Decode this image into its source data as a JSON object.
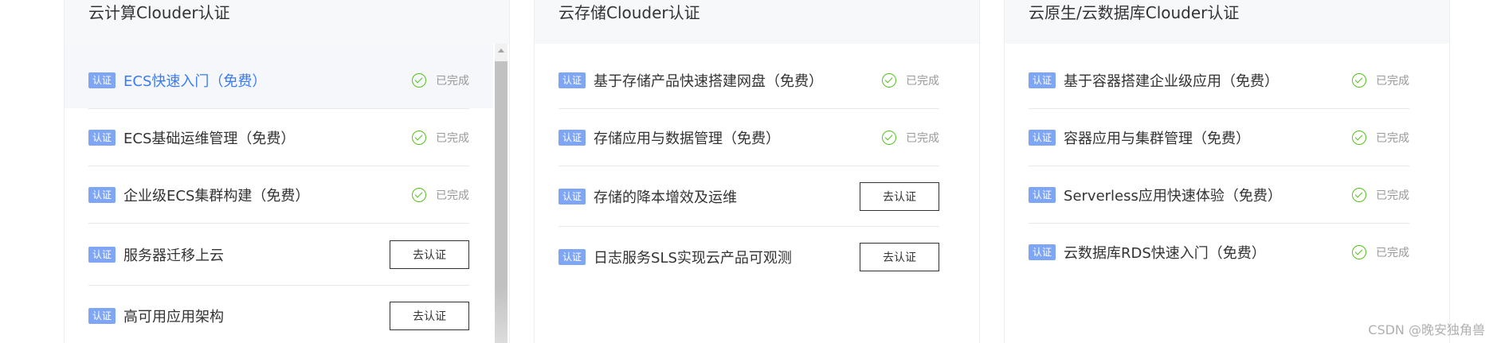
{
  "columns": [
    {
      "title": "云计算Clouder认证",
      "items": [
        {
          "tag": "认证",
          "title": "ECS快速入门（免费）",
          "status": "已完成"
        },
        {
          "tag": "认证",
          "title": "ECS基础运维管理（免费）",
          "status": "已完成"
        },
        {
          "tag": "认证",
          "title": "企业级ECS集群构建（免费）",
          "status": "已完成"
        },
        {
          "tag": "认证",
          "title": "服务器迁移上云",
          "action": "去认证"
        },
        {
          "tag": "认证",
          "title": "高可用应用架构",
          "action": "去认证"
        }
      ]
    },
    {
      "title": "云存储Clouder认证",
      "items": [
        {
          "tag": "认证",
          "title": "基于存储产品快速搭建网盘（免费）",
          "status": "已完成"
        },
        {
          "tag": "认证",
          "title": "存储应用与数据管理（免费）",
          "status": "已完成"
        },
        {
          "tag": "认证",
          "title": "存储的降本增效及运维",
          "action": "去认证"
        },
        {
          "tag": "认证",
          "title": "日志服务SLS实现云产品可观测",
          "action": "去认证"
        }
      ]
    },
    {
      "title": "云原生/云数据库Clouder认证",
      "items": [
        {
          "tag": "认证",
          "title": "基于容器搭建企业级应用（免费）",
          "status": "已完成"
        },
        {
          "tag": "认证",
          "title": "容器应用与集群管理（免费）",
          "status": "已完成"
        },
        {
          "tag": "认证",
          "title": "Serverless应用快速体验（免费）",
          "status": "已完成"
        },
        {
          "tag": "认证",
          "title": "云数据库RDS快速入门（免费）",
          "status": "已完成"
        }
      ]
    }
  ],
  "watermark": "CSDN @晚安独角兽"
}
